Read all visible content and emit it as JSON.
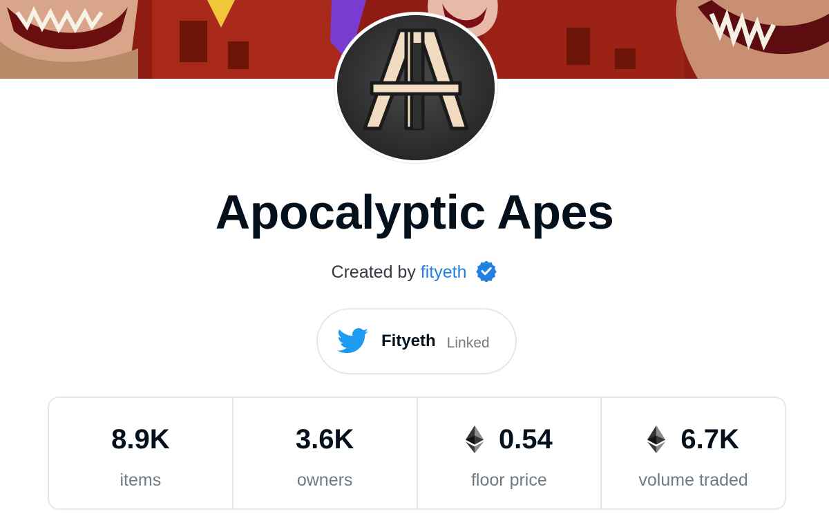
{
  "collection": {
    "name": "Apocalyptic Apes",
    "created_by_prefix": "Created by",
    "creator": "fityeth",
    "verified": true,
    "banner_icon": "banner-image",
    "avatar_icon": "collection-logo"
  },
  "twitter": {
    "icon": "twitter-icon",
    "handle": "Fityeth",
    "status": "Linked"
  },
  "stats": [
    {
      "value": "8.9K",
      "label": "items",
      "currency_icon": null
    },
    {
      "value": "3.6K",
      "label": "owners",
      "currency_icon": null
    },
    {
      "value": "0.54",
      "label": "floor price",
      "currency_icon": "ethereum-icon"
    },
    {
      "value": "6.7K",
      "label": "volume traded",
      "currency_icon": "ethereum-icon"
    }
  ],
  "colors": {
    "text_primary": "#04111d",
    "text_secondary": "#707a83",
    "link": "#2081e2",
    "border": "#e5e8eb",
    "twitter_blue": "#1d9bf0",
    "verified_blue": "#2081e2"
  }
}
